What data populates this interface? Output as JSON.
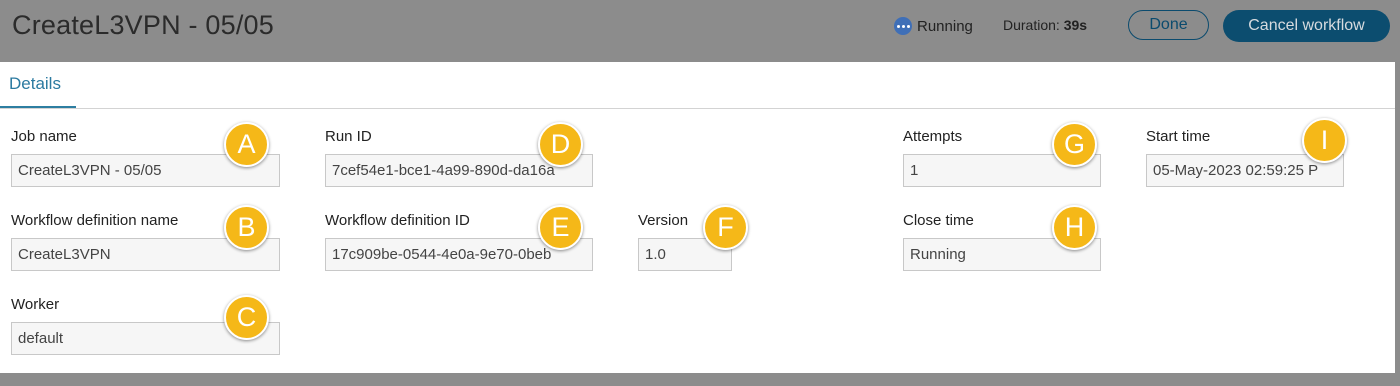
{
  "header": {
    "title": "CreateL3VPN - 05/05",
    "status_icon": "running-dots-icon",
    "status": "Running",
    "duration_label": "Duration:",
    "duration_value": "39s",
    "done_label": "Done",
    "cancel_label": "Cancel workflow"
  },
  "tabs": [
    {
      "label": "Details",
      "active": true
    }
  ],
  "fields": {
    "job_name": {
      "label": "Job name",
      "value": "CreateL3VPN - 05/05"
    },
    "workflow_definition_name": {
      "label": "Workflow definition name",
      "value": "CreateL3VPN"
    },
    "worker": {
      "label": "Worker",
      "value": "default"
    },
    "run_id": {
      "label": "Run ID",
      "value": "7cef54e1-bce1-4a99-890d-da16a"
    },
    "workflow_definition_id": {
      "label": "Workflow definition ID",
      "value": "17c909be-0544-4e0a-9e70-0beb"
    },
    "version": {
      "label": "Version",
      "value": "1.0"
    },
    "attempts": {
      "label": "Attempts",
      "value": "1"
    },
    "close_time": {
      "label": "Close time",
      "value": "Running"
    },
    "start_time": {
      "label": "Start time",
      "value": "05-May-2023 02:59:25 P"
    }
  },
  "markers": [
    "A",
    "B",
    "C",
    "D",
    "E",
    "F",
    "G",
    "H",
    "I"
  ],
  "colors": {
    "overlay": "#8c8c8c",
    "accent": "#0c4d6f",
    "tab_accent": "#2b7aa0",
    "marker": "#f5b818",
    "status_dot": "#3f6fb7"
  }
}
